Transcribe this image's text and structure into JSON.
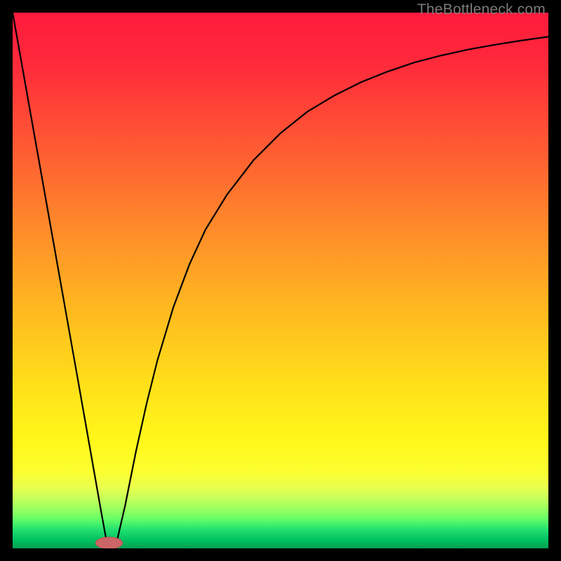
{
  "watermark": "TheBottleneck.com",
  "colors": {
    "frame": "#000000",
    "curve": "#000000",
    "marker_fill": "#cc6666",
    "marker_stroke": "#b94e4e",
    "gradient_stops": [
      {
        "offset": 0.0,
        "color": "#ff1a3d"
      },
      {
        "offset": 0.1,
        "color": "#ff2b3a"
      },
      {
        "offset": 0.25,
        "color": "#ff5a33"
      },
      {
        "offset": 0.4,
        "color": "#ff8a2a"
      },
      {
        "offset": 0.55,
        "color": "#ffb820"
      },
      {
        "offset": 0.7,
        "color": "#ffe11a"
      },
      {
        "offset": 0.8,
        "color": "#fff81a"
      },
      {
        "offset": 0.86,
        "color": "#fbff33"
      },
      {
        "offset": 0.885,
        "color": "#eaff4d"
      },
      {
        "offset": 0.905,
        "color": "#c9ff5a"
      },
      {
        "offset": 0.925,
        "color": "#9dff60"
      },
      {
        "offset": 0.945,
        "color": "#66ff66"
      },
      {
        "offset": 0.965,
        "color": "#22e06f"
      },
      {
        "offset": 0.985,
        "color": "#00c060"
      },
      {
        "offset": 1.0,
        "color": "#00a050"
      }
    ]
  },
  "chart_data": {
    "type": "line",
    "title": "",
    "xlabel": "",
    "ylabel": "",
    "xlim": [
      0,
      100
    ],
    "ylim": [
      0,
      100
    ],
    "note": "x is horizontal position (% of plot width), y is bottleneck % (0 at bottom/green, 100 at top/red). Curve has a sharp minimum near x≈17–19.",
    "series": [
      {
        "name": "bottleneck-curve",
        "x": [
          0,
          4,
          8,
          12,
          15,
          16.5,
          17.5,
          18.5,
          19.5,
          21,
          23,
          25,
          27,
          30,
          33,
          36,
          40,
          45,
          50,
          55,
          60,
          65,
          70,
          75,
          80,
          85,
          90,
          95,
          100
        ],
        "y": [
          100,
          77.5,
          55,
          32.5,
          15.5,
          7,
          1.5,
          1,
          1.5,
          8,
          18,
          27,
          35,
          45,
          53,
          59.5,
          66,
          72.5,
          77.5,
          81.5,
          84.5,
          87,
          89,
          90.7,
          92,
          93.1,
          94,
          94.8,
          95.5
        ]
      }
    ],
    "marker": {
      "x_center": 18,
      "y": 1,
      "rx": 2.5,
      "ry": 1.1
    }
  }
}
